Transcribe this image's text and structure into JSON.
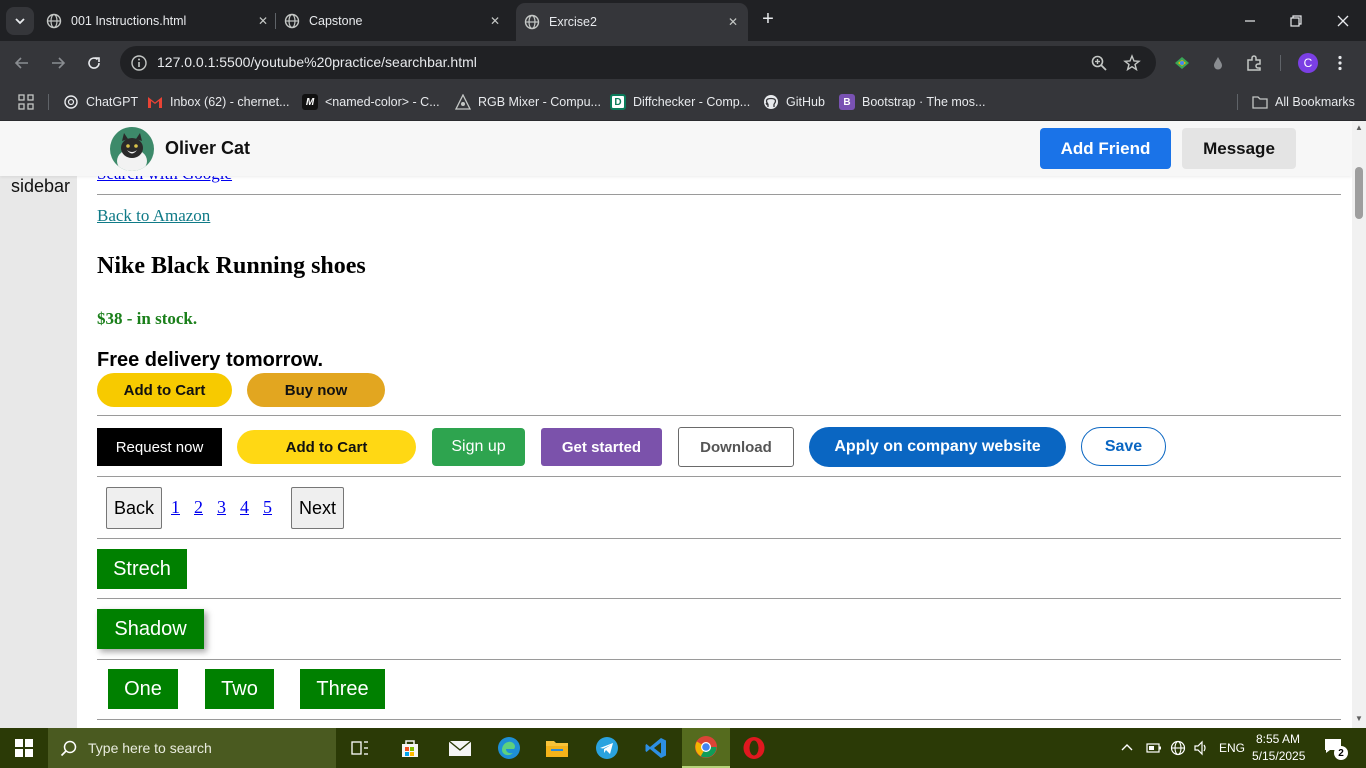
{
  "browser": {
    "tabs": [
      {
        "title": "001 Instructions.html",
        "active": false
      },
      {
        "title": "Capstone",
        "active": false
      },
      {
        "title": "Exrcise2",
        "active": true
      }
    ],
    "url": "127.0.0.1:5500/youtube%20practice/searchbar.html",
    "profile_initial": "C",
    "bookmarks": [
      {
        "label": "ChatGPT",
        "icon": "chatgpt-icon"
      },
      {
        "label": "Inbox (62) - chernet...",
        "icon": "gmail-icon"
      },
      {
        "label": "<named-color> - C...",
        "icon": "mdn-icon"
      },
      {
        "label": "RGB Mixer - Compu...",
        "icon": "rgb-mixer-icon"
      },
      {
        "label": "Diffchecker - Comp...",
        "icon": "diffchecker-icon"
      },
      {
        "label": "GitHub",
        "icon": "github-icon"
      },
      {
        "label": "Bootstrap · The mos...",
        "icon": "bootstrap-icon"
      }
    ],
    "all_bookmarks": "All Bookmarks"
  },
  "header": {
    "name": "Oliver Cat",
    "add_friend": "Add Friend",
    "message": "Message"
  },
  "sidebar": {
    "label": "sidebar"
  },
  "links": {
    "search_google": "Search with Google",
    "back_amazon": "Back to Amazon"
  },
  "product": {
    "title": "Nike Black Running shoes",
    "price": "$38 - in stock.",
    "delivery": "Free delivery tomorrow.",
    "add_to_cart": "Add to Cart",
    "buy_now": "Buy now"
  },
  "button_row": {
    "request_now": "Request now",
    "add_to_cart": "Add to Cart",
    "sign_up": "Sign up",
    "get_started": "Get started",
    "download": "Download",
    "apply": "Apply on company website",
    "save": "Save"
  },
  "pagination": {
    "back": "Back",
    "pages": [
      "1",
      "2",
      "3",
      "4",
      "5"
    ],
    "next": "Next"
  },
  "boxes": {
    "strech": "Strech",
    "shadow": "Shadow",
    "one": "One",
    "two": "Two",
    "three": "Three"
  },
  "taskbar": {
    "search_placeholder": "Type here to search",
    "language": "ENG",
    "time": "8:55 AM",
    "date": "5/15/2025",
    "notifications": "2"
  },
  "colors": {
    "add_friend": "#1a73e8",
    "price_green": "#1a7f1a",
    "yellow": "#f7ca00",
    "buy_now": "#e2a620",
    "sign_up": "#2ea44f",
    "get_started": "#7b52ab",
    "apply": "#0a66c2",
    "box_green": "#008000"
  }
}
